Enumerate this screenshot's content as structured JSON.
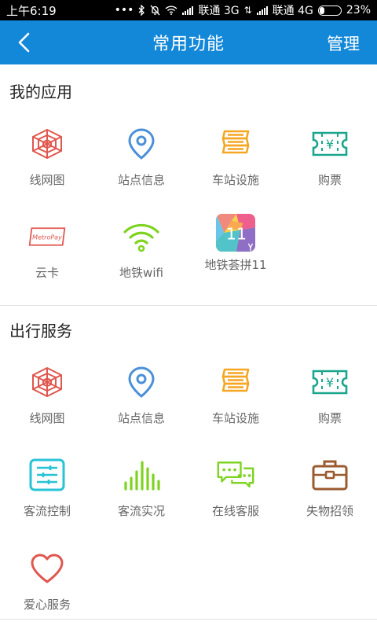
{
  "status_bar": {
    "time": "上午6:19",
    "carrier1": "联通 3G",
    "carrier2": "联通 4G",
    "battery": "23%",
    "battery_level": 0.23
  },
  "nav": {
    "title": "常用功能",
    "action": "管理",
    "back_icon": "chevron-left-icon"
  },
  "my_apps": {
    "title": "我的应用",
    "items": [
      {
        "label": "线网图",
        "icon": "web-icon"
      },
      {
        "label": "站点信息",
        "icon": "location-pin-icon"
      },
      {
        "label": "车站设施",
        "icon": "stack-icon"
      },
      {
        "label": "购票",
        "icon": "ticket-icon"
      },
      {
        "label": "云卡",
        "icon": "metropay-card-icon",
        "icon_text": "MetroPay"
      },
      {
        "label": "地铁wifi",
        "icon": "wifi-icon"
      },
      {
        "label": "地铁荟拼11",
        "icon": "app-tile-icon",
        "icon_text": "11"
      }
    ]
  },
  "travel_services": {
    "title": "出行服务",
    "items": [
      {
        "label": "线网图",
        "icon": "web-icon"
      },
      {
        "label": "站点信息",
        "icon": "location-pin-icon"
      },
      {
        "label": "车站设施",
        "icon": "stack-icon"
      },
      {
        "label": "购票",
        "icon": "ticket-icon"
      },
      {
        "label": "客流控制",
        "icon": "sliders-icon"
      },
      {
        "label": "客流实况",
        "icon": "bar-levels-icon"
      },
      {
        "label": "在线客服",
        "icon": "chat-bubbles-icon"
      },
      {
        "label": "失物招领",
        "icon": "briefcase-icon"
      },
      {
        "label": "爱心服务",
        "icon": "heart-icon"
      }
    ]
  },
  "colors": {
    "nav_blue": "#1488d8",
    "red": "#e0574f",
    "blue": "#4a90d9",
    "orange": "#f5a623",
    "teal": "#1aa68c",
    "green": "#7ed321",
    "cyan": "#27c3d6",
    "brown": "#9a5b2f"
  }
}
